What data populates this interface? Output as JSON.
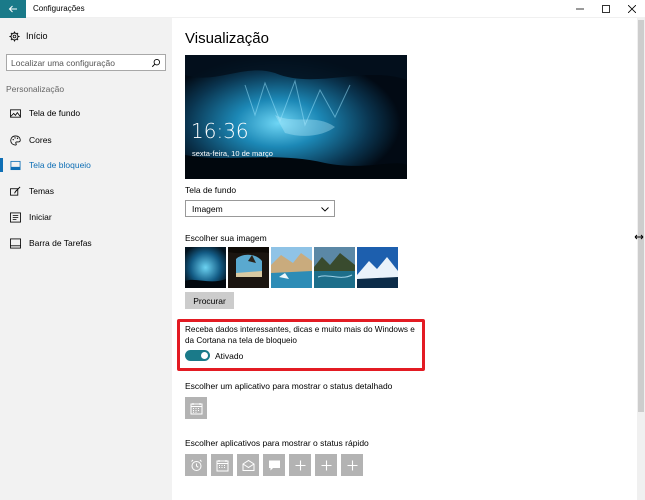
{
  "window": {
    "title": "Configurações"
  },
  "sidebar": {
    "home_label": "Início",
    "search_placeholder": "Localizar uma configuração",
    "section_label": "Personalização",
    "items": [
      {
        "label": "Tela de fundo",
        "icon": "picture-icon",
        "active": false
      },
      {
        "label": "Cores",
        "icon": "palette-icon",
        "active": false
      },
      {
        "label": "Tela de bloqueio",
        "icon": "lock-screen-icon",
        "active": true
      },
      {
        "label": "Temas",
        "icon": "brush-icon",
        "active": false
      },
      {
        "label": "Iniciar",
        "icon": "start-icon",
        "active": false
      },
      {
        "label": "Barra de Tarefas",
        "icon": "taskbar-icon",
        "active": false
      }
    ]
  },
  "main": {
    "title": "Visualização",
    "preview": {
      "time": "16:36",
      "date": "sexta-feira, 10 de março"
    },
    "background_label": "Tela de fundo",
    "background_value": "Imagem",
    "choose_image_label": "Escolher sua imagem",
    "browse_button": "Procurar",
    "fun_facts_text": "Receba dados interessantes, dicas e muito mais do Windows e da Cortana na tela de bloqueio",
    "toggle_state": "Ativado",
    "detailed_status_label": "Escolher um aplicativo para mostrar o status detalhado",
    "quick_status_label": "Escolher aplicativos para mostrar o status rápido"
  },
  "colors": {
    "accent": "#1a7a89",
    "highlight": "#e31b23",
    "link": "#0f6fb5"
  }
}
